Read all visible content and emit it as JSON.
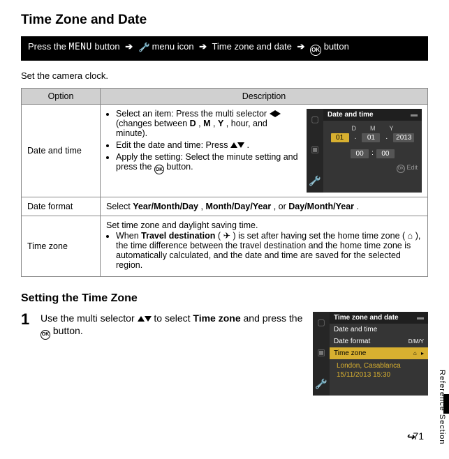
{
  "title": "Time Zone and Date",
  "breadcrumb": {
    "prefix": "Press the ",
    "menu": "MENU",
    "b1": " button ",
    "wrench_label": " menu icon ",
    "b3": "Time zone and date",
    "b4": " button"
  },
  "intro": "Set the camera clock.",
  "table": {
    "head_option": "Option",
    "head_desc": "Description",
    "rows": [
      {
        "label": "Date and time",
        "bullets": [
          {
            "pre": "Select an item: Press the multi selector ",
            "post": " (changes between ",
            "b1": "D",
            "mid1": ", ",
            "b2": "M",
            "mid2": ", ",
            "b3": "Y",
            "tail": ", hour, and minute)."
          },
          {
            "pre": "Edit the date and time: Press ",
            "post": "."
          },
          {
            "pre": "Apply the setting: Select the minute setting and press the ",
            "post": " button."
          }
        ]
      },
      {
        "label": "Date format",
        "text_pre": "Select ",
        "opt1": "Year/Month/Day",
        "sep1": ", ",
        "opt2": "Month/Day/Year",
        "sep2": ", or ",
        "opt3": "Day/Month/Year",
        "tail": "."
      },
      {
        "label": "Time zone",
        "line1": "Set time zone and daylight saving time.",
        "b2_pre": "When ",
        "b2_bold": "Travel destination",
        "b2_post": " (",
        "b2_after_icon": ") is set after having set the home time zone (",
        "b2_after_home": "), the time difference between the travel destination and the home time zone is automatically calculated, and the date and time are saved for the selected region."
      }
    ]
  },
  "screen1": {
    "title": "Date and time",
    "D": "D",
    "M": "M",
    "Y": "Y",
    "vD": "01",
    "vM": "01",
    "vY": "2013",
    "h": "00",
    "m": "00",
    "edit": "Edit"
  },
  "sub_heading": "Setting the Time Zone",
  "step": {
    "num": "1",
    "text_pre": "Use the multi selector ",
    "text_mid": " to select ",
    "bold": "Time zone",
    "text_post": " and press the ",
    "text_end": " button."
  },
  "screen2": {
    "title": "Time zone and date",
    "m1": "Date and time",
    "m2": "Date format",
    "m2r": "D/M/Y",
    "m3": "Time zone",
    "loc": "London, Casablanca",
    "dt": "15/11/2013  15:30"
  },
  "sideLabel": "Reference Section",
  "pageNum": "71"
}
